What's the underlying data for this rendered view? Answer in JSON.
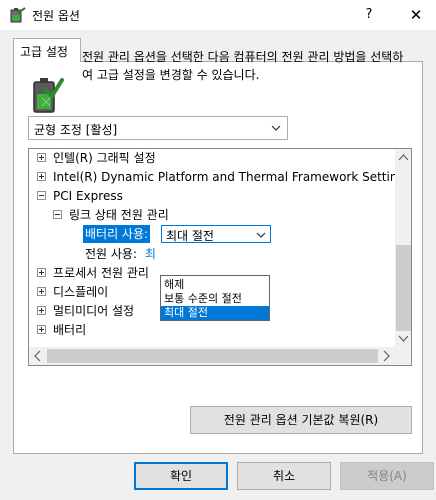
{
  "window": {
    "title": "전원 옵션",
    "help_glyph": "?",
    "close_glyph": "✕"
  },
  "tab": {
    "label": "고급 설정"
  },
  "description": "전원 관리 옵션을 선택한 다음 컴퓨터의 전원 관리 방법을 선택하여 고급 설정을 변경할 수 있습니다.",
  "plan_select": {
    "value": "균형 조정 [활성]"
  },
  "tree": {
    "items": [
      {
        "label": "인텔(R) 그래픽 설정",
        "expander": "+"
      },
      {
        "label": "Intel(R) Dynamic Platform and Thermal Framework Settings",
        "expander": "+"
      },
      {
        "label": "PCI Express",
        "expander": "-"
      },
      {
        "label": "링크 상태 전원 관리",
        "expander": "-"
      },
      {
        "label": "배터리 사용:",
        "value": "최대 절전"
      },
      {
        "label": "전원 사용:",
        "value": "최"
      },
      {
        "label": "프로세서 전원 관리",
        "expander": "+"
      },
      {
        "label": "디스플레이",
        "expander": "+"
      },
      {
        "label": "멀티미디어 설정",
        "expander": "+"
      },
      {
        "label": "배터리",
        "expander": "+"
      }
    ]
  },
  "dropdown": {
    "options": [
      "해제",
      "보통 수준의 절전",
      "최대 절전"
    ],
    "selected": "최대 절전"
  },
  "buttons": {
    "restore": "전원 관리 옵션 기본값 복원(R)",
    "ok": "확인",
    "cancel": "취소",
    "apply": "적용(A)"
  },
  "colors": {
    "selection": "#0078d7",
    "dialog_bg": "#f0f0f0",
    "disabled_text": "#838383"
  },
  "icons": {
    "title": "power-options-battery-icon",
    "header": "battery-check-icon",
    "combo_arrow": "chevron-down-icon"
  }
}
